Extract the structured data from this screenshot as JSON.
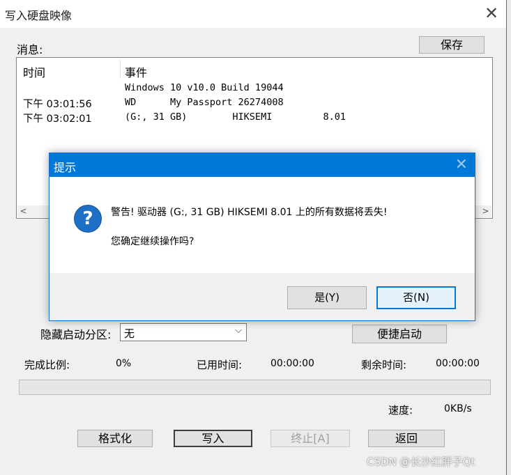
{
  "window": {
    "title": "写入硬盘映像",
    "close_glyph": "✕"
  },
  "messages": {
    "label": "消息:",
    "save_button": "保存",
    "columns": [
      "时间",
      "事件"
    ],
    "rows": [
      {
        "time": "",
        "event": "Windows 10 v10.0 Build 19044"
      },
      {
        "time": "下午 03:01:56",
        "event": "WD      My Passport 26274008"
      },
      {
        "time": "下午 03:02:01",
        "event": "(G:, 31 GB)        HIKSEMI         8.01"
      }
    ],
    "scroll_left": "<",
    "scroll_right": ">"
  },
  "hidden_partition": {
    "label": "隐藏启动分区:",
    "value": "无"
  },
  "quick_boot_button": "便捷启动",
  "progress": {
    "complete_label": "完成比例:",
    "complete_value": "0%",
    "elapsed_label": "已用时间:",
    "elapsed_value": "00:00:00",
    "remaining_label": "剩余时间:",
    "remaining_value": "00:00:00",
    "fraction": 0,
    "speed_label": "速度:",
    "speed_value": "0KB/s"
  },
  "buttons": {
    "format": "格式化",
    "write": "写入",
    "stop": "终止[A]",
    "back": "返回"
  },
  "dialog": {
    "title": "提示",
    "close_glyph": "✕",
    "icon": "question-icon",
    "icon_glyph": "?",
    "warning_line": "警告! 驱动器 (G:, 31 GB)      HIKSEMI       8.01 上的所有数据将丢失!",
    "confirm_line": "您确定继续操作吗?",
    "yes_button": "是(Y)",
    "no_button": "否(N)"
  },
  "watermark": "CSDN @长沙红胖子Qt",
  "colors": {
    "dialog_title": "#0078d7",
    "progress_fill": "#06b025",
    "question_icon": "#1e6fc6"
  }
}
